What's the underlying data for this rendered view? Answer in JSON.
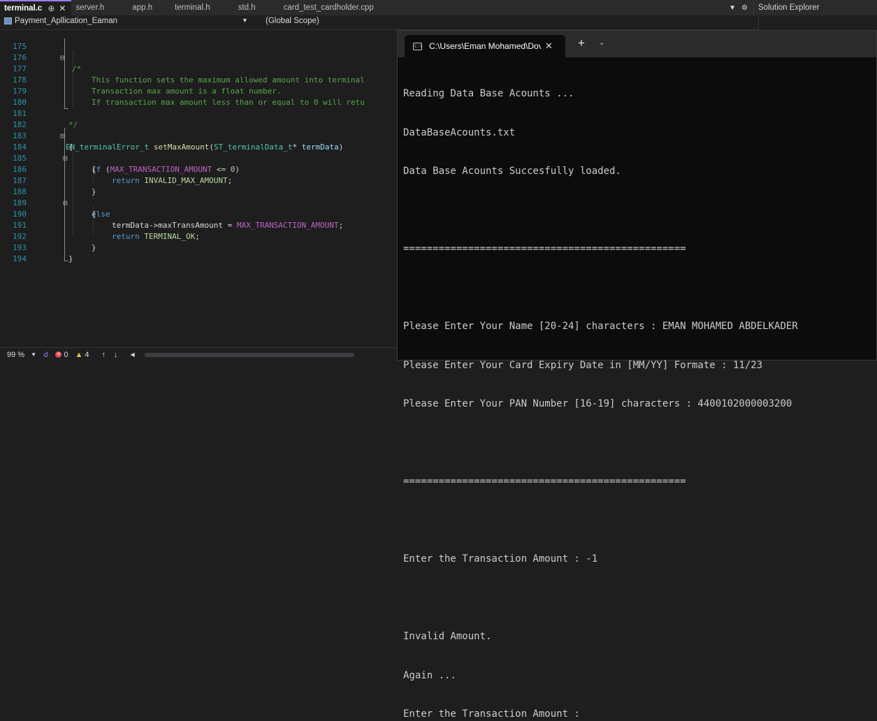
{
  "tabs": [
    {
      "label": "terminal.c",
      "active": true
    },
    {
      "label": "server.h"
    },
    {
      "label": "app.h"
    },
    {
      "label": "terminal.h"
    },
    {
      "label": "std.h"
    },
    {
      "label": "card_test_cardholder.cpp"
    }
  ],
  "icons": {
    "pin": "pin-icon",
    "close": "close-icon",
    "tab_overflow": "chevron-down-icon",
    "settings": "gear-icon"
  },
  "solution_explorer": {
    "title": "Solution Explorer"
  },
  "nav": {
    "project": "Payment_Apllication_Eaman",
    "scope": "(Global Scope)"
  },
  "code": {
    "line_numbers": [
      "175",
      "176",
      "177",
      "178",
      "179",
      "180",
      "181",
      "182",
      "183",
      "184",
      "185",
      "186",
      "187",
      "188",
      "189",
      "190",
      "191",
      "192",
      "193",
      "194"
    ],
    "comment_open": "/*",
    "comment_line1": "This function sets the maximum allowed amount into terminal",
    "comment_line2": "Transaction max amount is a float number.",
    "comment_line3": "If transaction max amount less than or equal to 0 will retu",
    "comment_close": "*/",
    "sig_type": "EN_terminalError_t",
    "sig_fn": "setMaxAmount",
    "sig_ptype": "ST_terminalData_t",
    "sig_star": "*",
    "sig_param": "termData",
    "open_brace": "{",
    "close_brace": "}",
    "kw_if": "if",
    "macro_max": "MAX_TRANSACTION_AMOUNT",
    "op_le": "<=",
    "num_zero": "0",
    "kw_return": "return",
    "enum_invalid": "INVALID_MAX_AMOUNT",
    "kw_else": "else",
    "member_ref": "termData->maxTransAmount",
    "op_assign": "=",
    "enum_ok": "TERMINAL_OK"
  },
  "status": {
    "zoom": "99 %",
    "errors": "0",
    "warnings": "4"
  },
  "terminal": {
    "tab_title": "C:\\Users\\Eman Mohamed\\Dov",
    "new_tab": "+",
    "background": "#0c0c0c",
    "lines": [
      "Reading Data Base Acounts ...",
      "DataBaseAcounts.txt",
      "Data Base Acounts Succesfully loaded.",
      "",
      "================================================",
      "",
      "Please Enter Your Name [20-24] characters : EMAN MOHAMED ABDELKADER",
      "Please Enter Your Card Expiry Date in [MM/YY] Formate : 11/23",
      "Please Enter Your PAN Number [16-19] characters : 4400102000003200",
      "",
      "================================================",
      "",
      "Enter the Transaction Amount : -1",
      "",
      "Invalid Amount.",
      "Again ...",
      "Enter the Transaction Amount :"
    ]
  }
}
